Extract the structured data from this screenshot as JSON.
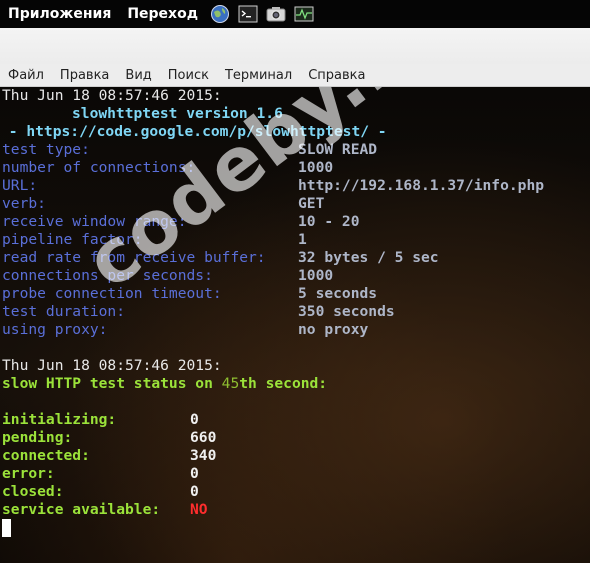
{
  "panel": {
    "applications": "Приложения",
    "places": "Переход",
    "icons": [
      "globe-icon",
      "terminal-icon",
      "camera-icon",
      "system-monitor-icon"
    ]
  },
  "menubar": {
    "items": [
      "Файл",
      "Правка",
      "Вид",
      "Поиск",
      "Терминал",
      "Справка"
    ]
  },
  "terminal": {
    "timestamp1": "Thu Jun 18 08:57:46 2015:",
    "version": "slowhttptest version 1.6",
    "url_line": " - https://code.google.com/p/slowhttptest/ -",
    "config": [
      {
        "label": "test type:",
        "value": "SLOW READ"
      },
      {
        "label": "number of connections:",
        "value": "1000"
      },
      {
        "label": "URL:",
        "value": "http://192.168.1.37/info.php"
      },
      {
        "label": "verb:",
        "value": "GET"
      },
      {
        "label": "receive window range:",
        "value": "10 - 20"
      },
      {
        "label": "pipeline factor:",
        "value": "1"
      },
      {
        "label": "read rate from receive buffer:",
        "value": "32 bytes / 5 sec"
      },
      {
        "label": "connections per seconds:",
        "value": "1000"
      },
      {
        "label": "probe connection timeout:",
        "value": "5 seconds"
      },
      {
        "label": "test duration:",
        "value": "350 seconds"
      },
      {
        "label": "using proxy:",
        "value": "no proxy"
      }
    ],
    "timestamp2": "Thu Jun 18 08:57:46 2015:",
    "status_prefix": "slow HTTP test status on ",
    "status_seconds": "45",
    "status_suffix": "th second:",
    "status": [
      {
        "label": "initializing:",
        "value": "0"
      },
      {
        "label": "pending:",
        "value": "660"
      },
      {
        "label": "connected:",
        "value": "340"
      },
      {
        "label": "error:",
        "value": "0"
      },
      {
        "label": "closed:",
        "value": "0"
      },
      {
        "label": "service available:",
        "value": "NO"
      }
    ]
  },
  "watermark": "codeby.net",
  "colors": {
    "label_blue": "#5a6fd8",
    "value_grey": "#aeb6c8",
    "header_cyan": "#7fd6f4",
    "status_green": "#9be23a",
    "alert_red": "#ff2d2d"
  }
}
